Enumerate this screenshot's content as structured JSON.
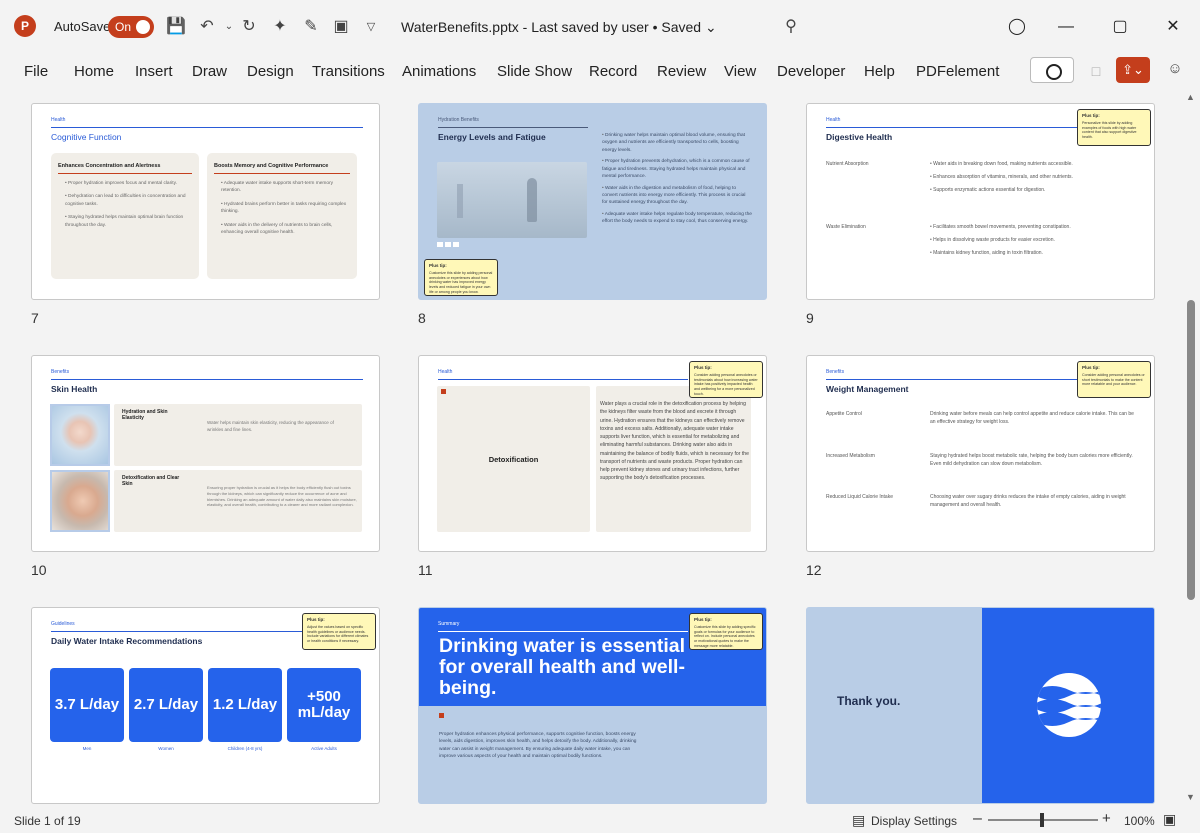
{
  "titlebar": {
    "app_logo": "P",
    "autosave_label": "AutoSave",
    "autosave_state": "On",
    "doc_title": "WaterBenefits.pptx  -  Last saved by user  •  Saved ⌄",
    "icons": [
      "save-icon",
      "undo-icon",
      "redo-icon",
      "magic-wand-icon",
      "pen-icon",
      "present-icon",
      "customize-icon",
      "search-icon",
      "lightbulb-icon",
      "minimize-icon",
      "maximize-icon",
      "close-icon"
    ]
  },
  "ribbon": {
    "tabs": [
      "File",
      "Home",
      "Insert",
      "Draw",
      "Design",
      "Transitions",
      "Animations",
      "Slide Show",
      "Record",
      "Review",
      "View",
      "Developer",
      "Help",
      "PDFelement"
    ]
  },
  "common": {
    "plus_tip": "Plus tip:"
  },
  "slides": {
    "s7": {
      "num": "7",
      "eyebrow": "Health",
      "title": "Cognitive Function",
      "p1_title": "Enhances Concentration and Alertness",
      "p1_items": [
        "Proper hydration improves focus and mental clarity.",
        "Dehydration can lead to difficulties in concentration and cognitive tasks.",
        "Staying hydrated helps maintain optimal brain function throughout the day."
      ],
      "p2_title": "Boosts Memory and Cognitive Performance",
      "p2_items": [
        "Adequate water intake supports short-term memory retention.",
        "Hydrated brains perform better in tasks requiring complex thinking.",
        "Water aids in the delivery of nutrients to brain cells, enhancing overall cognitive health."
      ]
    },
    "s8": {
      "num": "8",
      "eyebrow": "Hydration Benefits",
      "title": "Energy Levels and Fatigue",
      "items": [
        "Drinking water helps maintain optimal blood volume, ensuring that oxygen and nutrients are efficiently transported to cells, boosting energy levels.",
        "Proper hydration prevents dehydration, which is a common cause of fatigue and tiredness. Staying hydrated helps maintain physical and mental performance.",
        "Water aids in the digestion and metabolism of food, helping to convert nutrients into energy more efficiently. This process is crucial for sustained energy throughout the day.",
        "Adequate water intake helps regulate body temperature, reducing the effort the body needs to expend to stay cool, thus conserving energy."
      ],
      "tip": "Customize this slide by adding personal anecdotes or experiences about how drinking water has improved energy levels and reduced fatigue in your own life or among people you know."
    },
    "s9": {
      "num": "9",
      "eyebrow": "Health",
      "title": "Digestive Health",
      "row1_label": "Nutrient Absorption",
      "row1_items": [
        "Water aids in breaking down food, making nutrients accessible.",
        "Enhances absorption of vitamins, minerals, and other nutrients.",
        "Supports enzymatic actions essential for digestion."
      ],
      "row2_label": "Waste Elimination",
      "row2_items": [
        "Facilitates smooth bowel movements, preventing constipation.",
        "Helps in dissolving waste products for easier excretion.",
        "Maintains kidney function, aiding in toxin filtration."
      ],
      "tip": "Personalize this slide by adding examples of foods with high water content that also support digestive health."
    },
    "s10": {
      "num": "10",
      "eyebrow": "Benefits",
      "title": "Skin Health",
      "r1_label": "Hydration and Skin Elasticity",
      "r1_text": "Water helps maintain skin elasticity, reducing the appearance of wrinkles and fine lines.",
      "r2_label": "Detoxification and Clear Skin",
      "r2_text": "Ensuring proper hydration is crucial as it helps the body efficiently flush out toxins through the kidneys, which can significantly reduce the occurrence of acne and blemishes. Drinking an adequate amount of water daily also maintains skin moisture, elasticity, and overall health, contributing to a clearer and more radiant complexion."
    },
    "s11": {
      "num": "11",
      "eyebrow": "Health",
      "box_label": "Detoxification",
      "text": "Water plays a crucial role in the detoxification process by helping the kidneys filter waste from the blood and excrete it through urine. Hydration ensures that the kidneys can effectively remove toxins and excess salts. Additionally, adequate water intake supports liver function, which is essential for metabolizing and eliminating harmful substances. Drinking water also aids in maintaining the balance of bodily fluids, which is necessary for the transport of nutrients and waste products. Proper hydration can help prevent kidney stones and urinary tract infections, further supporting the body's detoxification processes.",
      "tip": "Consider adding personal anecdotes or testimonials about how increasing water intake has positively impacted health and wellbeing for a more personalized touch."
    },
    "s12": {
      "num": "12",
      "eyebrow": "Benefits",
      "title": "Weight Management",
      "rows": [
        {
          "label": "Appetite Control",
          "text": "Drinking water before meals can help control appetite and reduce calorie intake. This can be an effective strategy for weight loss."
        },
        {
          "label": "Increased Metabolism",
          "text": "Staying hydrated helps boost metabolic rate, helping the body burn calories more efficiently. Even mild dehydration can slow down metabolism."
        },
        {
          "label": "Reduced Liquid Calorie Intake",
          "text": "Choosing water over sugary drinks reduces the intake of empty calories, aiding in weight management and overall health."
        }
      ],
      "tip": "Consider adding personal anecdotes or short testimonials to make the content more relatable and your audience."
    },
    "s13": {
      "eyebrow": "Guidelines",
      "title": "Daily Water Intake Recommendations",
      "stats": [
        {
          "value": "3.7 L/day",
          "label": "Men"
        },
        {
          "value": "2.7 L/day",
          "label": "Women"
        },
        {
          "value": "1.2 L/day",
          "label": "Children (4-8 yrs)"
        },
        {
          "value": "+500 mL/day",
          "label": "Active Adults"
        }
      ],
      "tip": "Adjust the values based on specific health guidelines or audience needs. Include variations for different climates or health conditions if necessary."
    },
    "s14": {
      "eyebrow": "Summary",
      "headline": "Drinking water is essential for overall health and well-being.",
      "body": "Proper hydration enhances physical performance, supports cognitive function, boosts energy levels, aids digestion, improves skin health, and helps detoxify the body. Additionally, drinking water can assist in weight management. By ensuring adequate daily water intake, you can improve various aspects of your health and maintain optimal bodily functions.",
      "tip": "Customize this slide by adding specific goals or formulas for your audience to reflect on. Include personal anecdotes or motivational quotes to make the message more relatable."
    },
    "s15": {
      "text": "Thank you."
    }
  },
  "status": {
    "slide_info": "Slide 1 of 19",
    "display_settings": "Display Settings",
    "zoom": "100%"
  },
  "colors": {
    "accent": "#c43e1c",
    "blue": "#2563eb",
    "panel": "#f1eee8",
    "tip": "#fff8b8"
  }
}
